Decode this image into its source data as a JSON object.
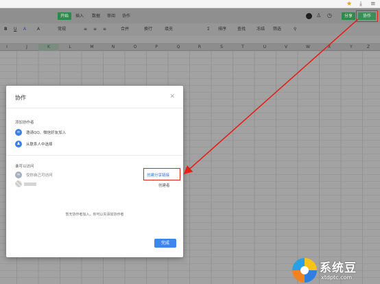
{
  "browser": {
    "star_icon": "star-icon",
    "download_icon": "download-icon",
    "menu_icon": "menu-icon"
  },
  "toolbar": {
    "tabs": [
      "开始",
      "插入",
      "数据",
      "审阅",
      "协作"
    ],
    "share_label": "分享",
    "collab_label": "协作",
    "format_items": [
      "B",
      "U",
      "A",
      "A",
      "常规",
      "合并",
      "换行",
      "填充",
      "排序",
      "查找",
      "冻结",
      "筛选",
      "查找"
    ]
  },
  "sheet": {
    "columns": [
      "I",
      "J",
      "K",
      "L",
      "M",
      "N",
      "O",
      "P",
      "Q",
      "R",
      "S",
      "T",
      "U",
      "V",
      "W",
      "X",
      "Y",
      "Z"
    ],
    "selected_column": "K"
  },
  "modal": {
    "title": "协作",
    "add_section": "添加协作者",
    "qq_wechat": "邀请QQ、微信好友加入",
    "from_contacts": "从联系人中选择",
    "access_section": "谁可以访问",
    "only_me": "仅你自己可访问",
    "create_link": "创建分享链接",
    "creator": "创建者",
    "empty_hint": "暂无协作者加入，你可以先添加协作者",
    "done": "完成"
  },
  "watermark": {
    "title": "系统豆",
    "url": "xtdptc.com"
  },
  "colors": {
    "accent_green": "#2e8a4a",
    "link_blue": "#3272d6",
    "button_blue": "#3d86ee",
    "annotation_red": "#e5211a"
  }
}
